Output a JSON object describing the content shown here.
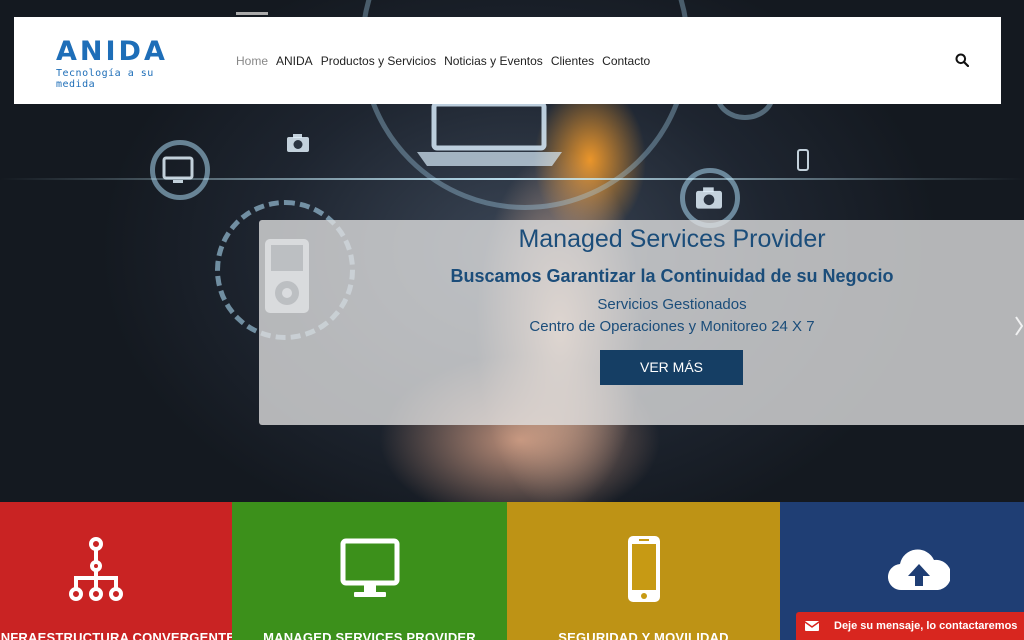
{
  "header": {
    "logo_name": "ANIDA",
    "logo_tagline": "Tecnología a su medida",
    "nav": [
      {
        "label": "Home",
        "active": true
      },
      {
        "label": "ANIDA",
        "active": false
      },
      {
        "label": "Productos y Servicios",
        "active": false
      },
      {
        "label": "Noticias y Eventos",
        "active": false
      },
      {
        "label": "Clientes",
        "active": false
      },
      {
        "label": "Contacto",
        "active": false
      }
    ],
    "search_icon": "search-icon"
  },
  "slider": {
    "title": "Managed Services Provider",
    "subtitle": "Buscamos Garantizar la Continuidad de su Negocio",
    "line1": "Servicios Gestionados",
    "line2": "Centro de Operaciones y Monitoreo 24 X 7",
    "button": "VER MÁS",
    "next_icon": "chevron-right-icon"
  },
  "tiles": [
    {
      "label": "INFRAESTRUCTURA CONVERGENTE",
      "color": "#c92323",
      "icon": "network-hierarchy-icon"
    },
    {
      "label": "MANAGED SERVICES PROVIDER",
      "color": "#3f9a1a",
      "icon": "monitor-icon"
    },
    {
      "label": "SEGURIDAD Y MOVILIDAD",
      "color": "#c79a14",
      "icon": "smartphone-icon"
    },
    {
      "label": "",
      "color": "#1f3e74",
      "icon": "cloud-upload-icon"
    }
  ],
  "chat": {
    "label": "Deje su mensaje, lo contactaremos",
    "icon": "envelope-icon"
  },
  "colors": {
    "brand": "#1e6eb8",
    "caption_text": "#1b4d7a",
    "button_bg": "#153e64",
    "chat_bg": "#d8261f"
  }
}
